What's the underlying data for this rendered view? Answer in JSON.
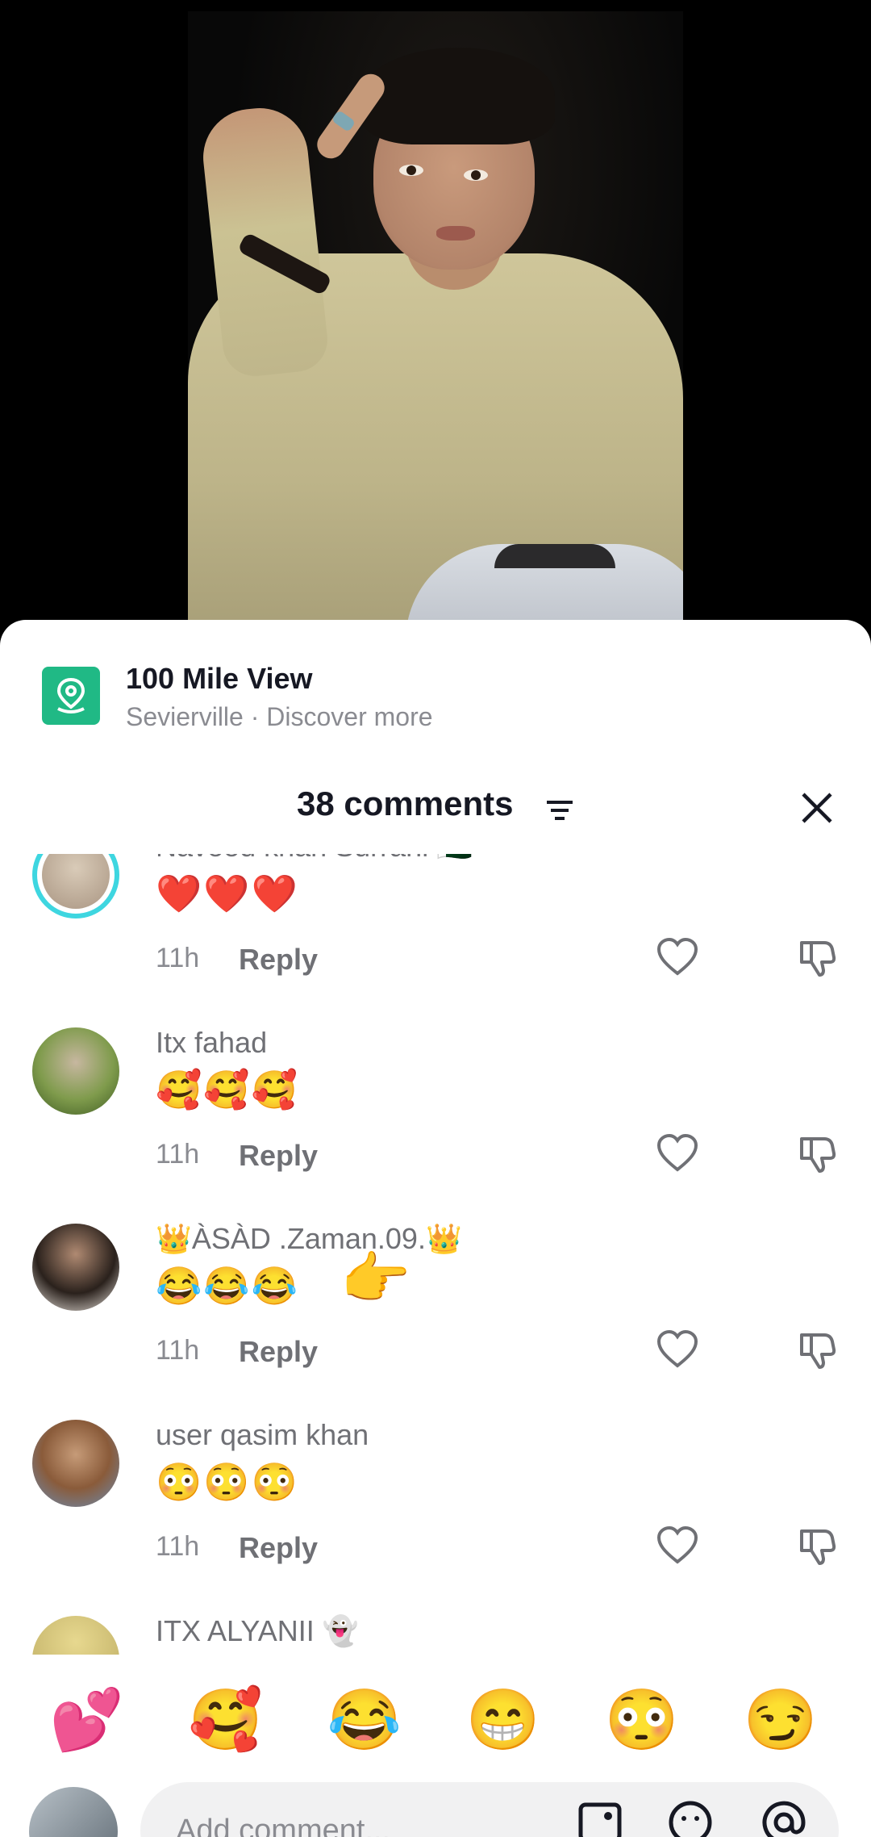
{
  "location": {
    "title": "100 Mile View",
    "subtitle": "Sevierville · Discover more"
  },
  "header": {
    "comments_count_label": "38 comments"
  },
  "comments": [
    {
      "name": "Naveed khan Surrani 🇵🇰",
      "text": "❤️❤️❤️",
      "time": "11h",
      "reply": "Reply",
      "avatar_color": "#c9b9a8"
    },
    {
      "name": "Itx fahad",
      "text": "🥰🥰🥰",
      "time": "11h",
      "reply": "Reply",
      "avatar_color": "#5a8a3a"
    },
    {
      "name": "👑ÀSÀD .Zaman.09.👑",
      "text": "😂😂😂",
      "time": "11h",
      "reply": "Reply",
      "pointer": "👉",
      "avatar_color": "#3a2f2a"
    },
    {
      "name": "user qasim khan",
      "text": "😳😳😳",
      "time": "11h",
      "reply": "Reply",
      "avatar_color": "#6a8db5"
    },
    {
      "name": "ITX ALYANII 👻",
      "text": "",
      "time": "",
      "reply": "",
      "avatar_color": "#d8c98a"
    }
  ],
  "quick_emojis": [
    "💕",
    "🥰",
    "😂",
    "😁",
    "😳",
    "😏"
  ],
  "input": {
    "placeholder": "Add comment..."
  },
  "colors": {
    "accent_location": "#20b985",
    "story_ring": "#3ed6e0"
  },
  "icons": [
    "location-pin-icon",
    "filter-icon",
    "close-icon",
    "heart-icon",
    "dislike-icon",
    "image-icon",
    "emoji-icon",
    "mention-icon"
  ]
}
